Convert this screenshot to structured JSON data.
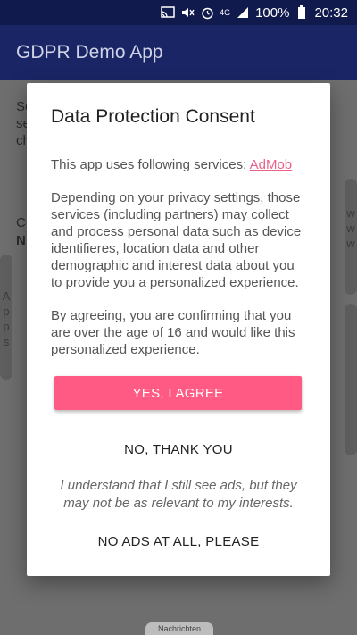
{
  "status_bar": {
    "battery": "100%",
    "time": "20:32",
    "network": "4G",
    "icons": [
      "cast-icon",
      "mute-icon",
      "alarm-icon",
      "signal-icon",
      "battery-icon"
    ]
  },
  "app_bar": {
    "title": "GDPR Demo App"
  },
  "background": {
    "partial_lines": [
      "So",
      "se",
      "ch"
    ],
    "partial_label": "Cu",
    "partial_bold": "N",
    "left_pill_text": "A p p s",
    "right_pill_text": "w w w"
  },
  "dialog": {
    "title": "Data Protection Consent",
    "services_text": "This app uses following services: ",
    "services_link": "AdMob",
    "paragraph1": "Depending on your privacy settings, those services (including partners) may collect and process personal data such as device identifieres, location data and other demographic and interest data about you to provide you a personalized experience.",
    "paragraph2": "By agreeing, you are confirming that you are over the age of 16 and would like this personalized experience.",
    "agree_button": "YES, I AGREE",
    "decline_button": "NO, THANK YOU",
    "ads_note": "I understand that I still see ads, but they may not be as relevant to my interests.",
    "no_ads_button": "NO ADS AT ALL, PLEASE"
  },
  "nav_hint": "Nachrichten",
  "colors": {
    "status_bar": "#101a4d",
    "app_bar": "#1a2566",
    "accent": "#ff5a83",
    "link": "#e8638a"
  }
}
